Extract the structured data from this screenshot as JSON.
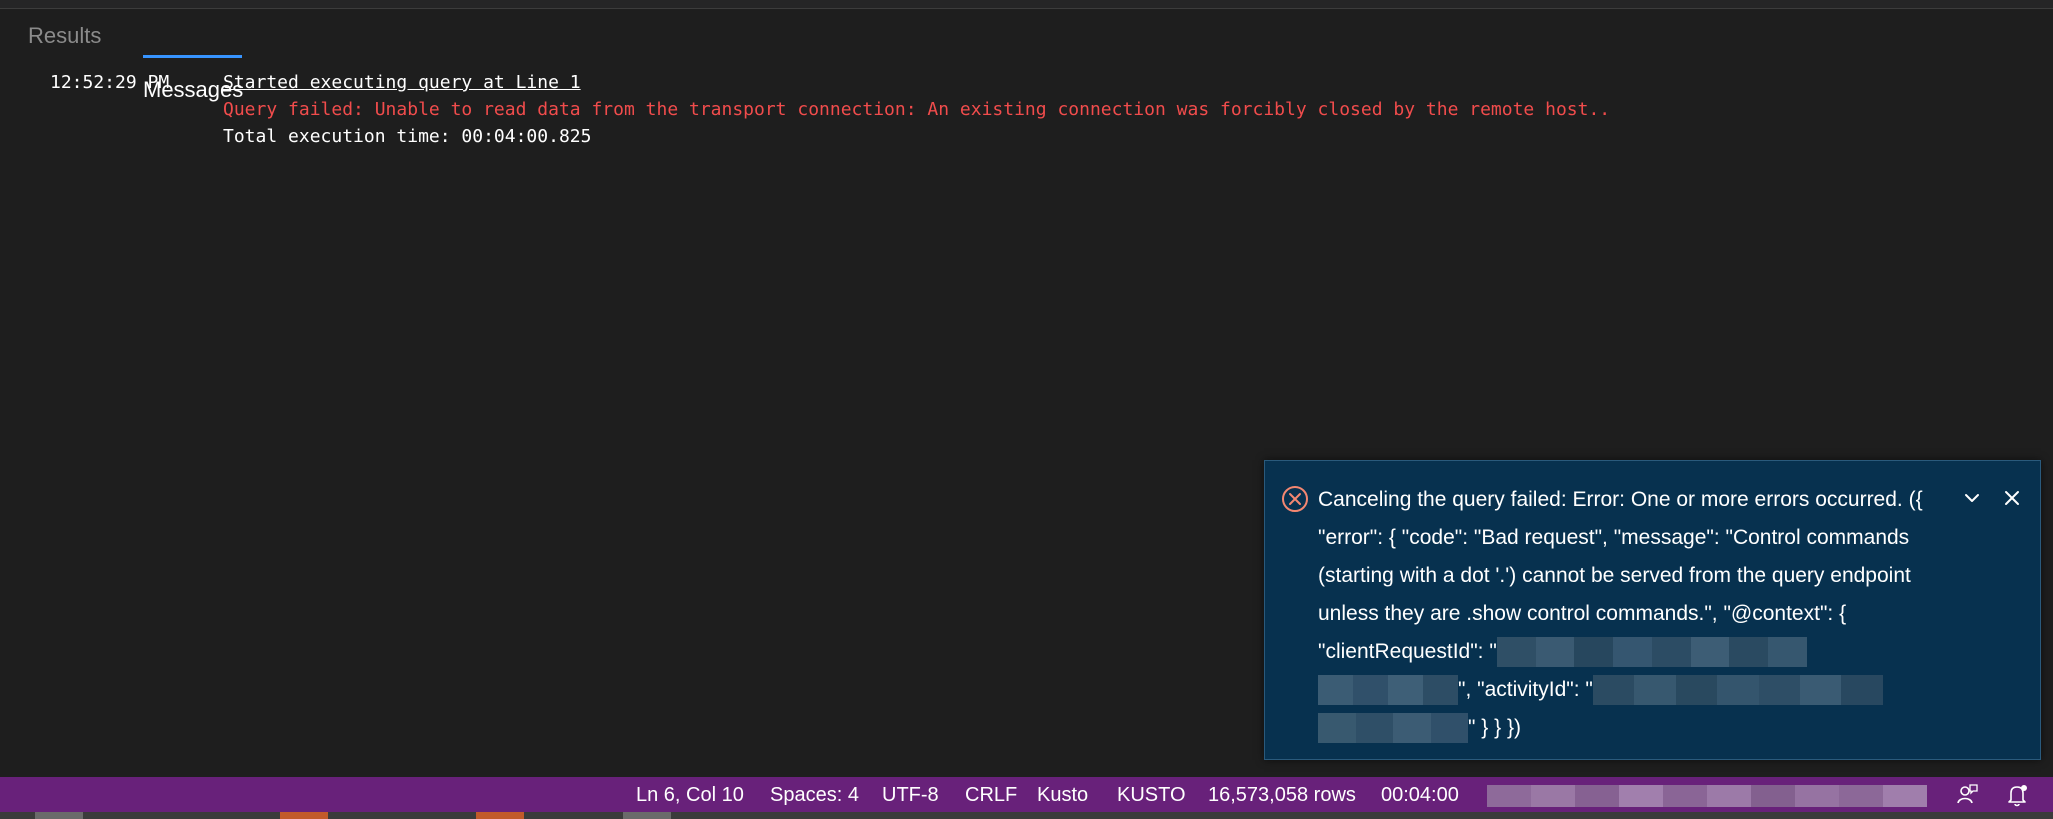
{
  "tabs": {
    "results": "Results",
    "messages": "Messages"
  },
  "messages": {
    "time": "12:52:29 PM",
    "started": "Started executing query at Line 1",
    "error": "Query failed: Unable to read data from the transport connection: An existing connection was forcibly closed by the remote host..",
    "total": "Total execution time: 00:04:00.825"
  },
  "notification": {
    "text_part1": "Canceling the query failed: Error: One or more errors occurred. ({ \"error\": { \"code\": \"Bad request\", \"message\": \"Control commands (starting with a dot '.') cannot be served from the query endpoint unless they are .show control commands.\", \"@context\": { \"clientRequestId\": \"",
    "text_part2": "\", \"activityId\": \"",
    "text_part3": "\" } } })",
    "icons": [
      "error-circle-icon",
      "chevron-down-icon",
      "close-icon"
    ]
  },
  "statusbar": {
    "position": "Ln 6, Col 10",
    "spaces": "Spaces: 4",
    "encoding": "UTF-8",
    "eol": "CRLF",
    "language": "Kusto",
    "connection": "KUSTO",
    "rows": "16,573,058 rows",
    "elapsed": "00:04:00",
    "icons": [
      "feedback-icon",
      "bell-icon"
    ]
  },
  "colors": {
    "editor_bg": "#1e1e1e",
    "statusbar_bg": "#68217a",
    "toast_bg": "#07314f",
    "error_text": "#f14c4c",
    "tab_accent": "#3794ff"
  }
}
